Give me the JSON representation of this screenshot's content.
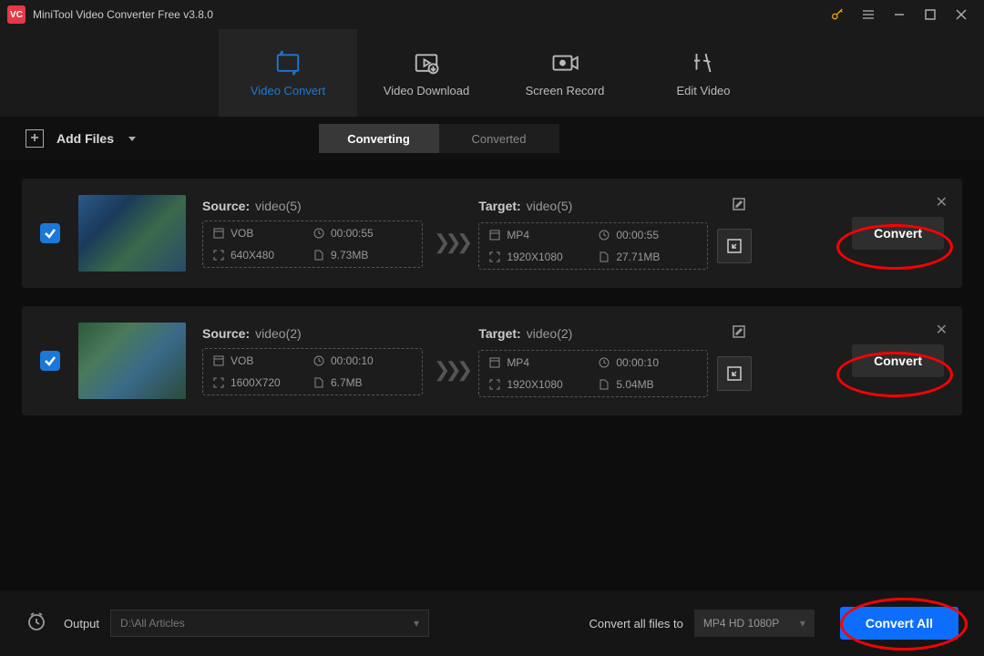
{
  "titlebar": {
    "app_name": "VC",
    "title": "MiniTool Video Converter Free v3.8.0"
  },
  "nav": {
    "items": [
      {
        "label": "Video Convert"
      },
      {
        "label": "Video Download"
      },
      {
        "label": "Screen Record"
      },
      {
        "label": "Edit Video"
      }
    ]
  },
  "toolbar": {
    "add_files_label": "Add Files",
    "tabs": {
      "converting": "Converting",
      "converted": "Converted"
    }
  },
  "files": [
    {
      "source_prefix": "Source:",
      "source_name": "video(5)",
      "src": {
        "fmt": "VOB",
        "dur": "00:00:55",
        "res": "640X480",
        "size": "9.73MB"
      },
      "target_prefix": "Target:",
      "target_name": "video(5)",
      "tgt": {
        "fmt": "MP4",
        "dur": "00:00:55",
        "res": "1920X1080",
        "size": "27.71MB"
      },
      "convert_label": "Convert"
    },
    {
      "source_prefix": "Source:",
      "source_name": "video(2)",
      "src": {
        "fmt": "VOB",
        "dur": "00:00:10",
        "res": "1600X720",
        "size": "6.7MB"
      },
      "target_prefix": "Target:",
      "target_name": "video(2)",
      "tgt": {
        "fmt": "MP4",
        "dur": "00:00:10",
        "res": "1920X1080",
        "size": "5.04MB"
      },
      "convert_label": "Convert"
    }
  ],
  "bottom": {
    "output_label": "Output",
    "output_path": "D:\\All Articles",
    "all_label": "Convert all files to",
    "all_format": "MP4 HD 1080P",
    "convert_all_label": "Convert All"
  },
  "colors": {
    "accent": "#1a79d8",
    "primary": "#0d6efd",
    "highlight": "#ff0000"
  }
}
